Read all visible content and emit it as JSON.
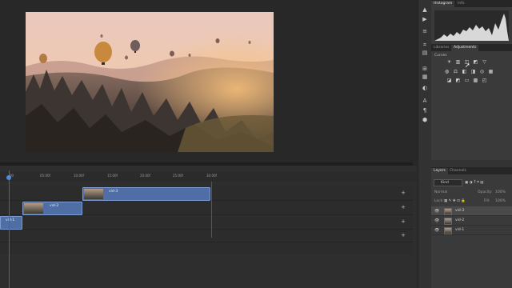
{
  "panels": {
    "top_tabs": [
      "Histogram",
      "Info"
    ],
    "mid_tabs": [
      "Libraries",
      "Adjustments"
    ],
    "adjustments_title": "Curves",
    "adjustments_icons_row1": [
      "☀",
      "▥",
      "◫",
      "◩",
      "▽"
    ],
    "adjustments_icons_row2": [
      "◍",
      "⚖",
      "◧",
      "◨",
      "◎",
      "▦"
    ],
    "adjustments_icons_row3": [
      "◪",
      "◩",
      "▭",
      "▩",
      "◰"
    ],
    "layer_tabs": [
      "Layers",
      "Channels"
    ],
    "kind_label": "Kind",
    "blend_mode": "Normal",
    "opacity_label": "Opacity:",
    "opacity_value": "100%",
    "lock_label": "Lock:",
    "fill_label": "Fill:",
    "fill_value": "100%",
    "layers": [
      {
        "name": "vid-3",
        "selected": true
      },
      {
        "name": "vid-2",
        "selected": false
      },
      {
        "name": "vid-1",
        "selected": false
      }
    ]
  },
  "timeline": {
    "ticks": [
      "00",
      "05:00f",
      "10:00f",
      "15:00f",
      "20:00f",
      "25:00f",
      "30:00f"
    ],
    "clips": [
      {
        "name": "vid-3"
      },
      {
        "name": "vid-2"
      },
      {
        "name": "vid-1"
      }
    ],
    "add_label": "+"
  },
  "toolstrip": {
    "icons": [
      "▲",
      "▶",
      "≡",
      "⌗",
      "▤",
      "⊞",
      "▦",
      "◐",
      "☷",
      "A",
      "¶",
      "⬢"
    ]
  }
}
